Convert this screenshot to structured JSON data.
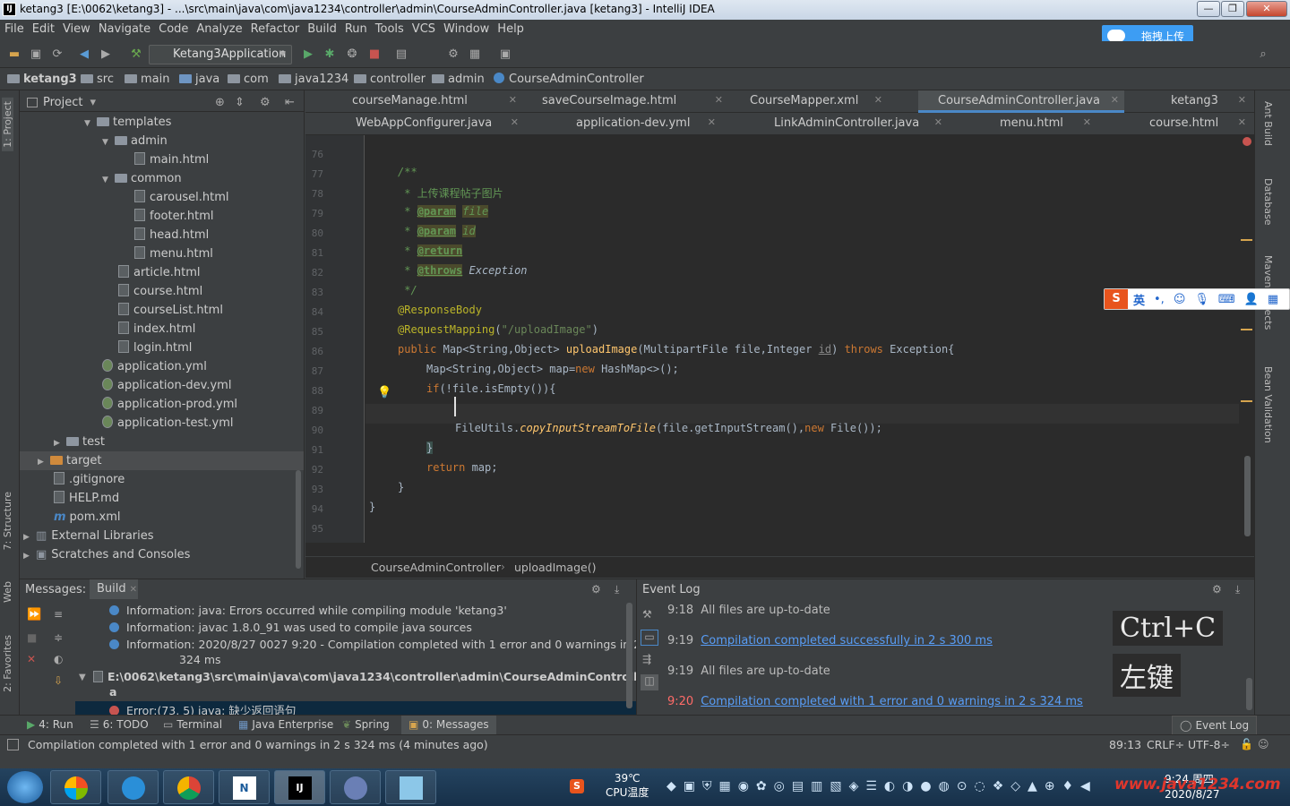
{
  "window": {
    "title": "ketang3 [E:\\0062\\ketang3] - ...\\src\\main\\java\\com\\java1234\\controller\\admin\\CourseAdminController.java [ketang3] - IntelliJ IDEA",
    "icon": "IJ"
  },
  "menu": [
    "File",
    "Edit",
    "View",
    "Navigate",
    "Code",
    "Analyze",
    "Refactor",
    "Build",
    "Run",
    "Tools",
    "VCS",
    "Window",
    "Help"
  ],
  "toolbar": {
    "run_config": "Ketang3Application"
  },
  "upload_button": "拖拽上传",
  "breadcrumb": [
    "ketang3",
    "src",
    "main",
    "java",
    "com",
    "java1234",
    "controller",
    "admin",
    "CourseAdminController"
  ],
  "project_panel": {
    "title": "Project",
    "tree": [
      {
        "label": "templates",
        "type": "folder",
        "open": true
      },
      {
        "label": "admin",
        "type": "folder",
        "open": true
      },
      {
        "label": "main.html",
        "type": "html"
      },
      {
        "label": "common",
        "type": "folder",
        "open": true
      },
      {
        "label": "carousel.html",
        "type": "html"
      },
      {
        "label": "footer.html",
        "type": "html"
      },
      {
        "label": "head.html",
        "type": "html"
      },
      {
        "label": "menu.html",
        "type": "html"
      },
      {
        "label": "article.html",
        "type": "html"
      },
      {
        "label": "course.html",
        "type": "html"
      },
      {
        "label": "courseList.html",
        "type": "html"
      },
      {
        "label": "index.html",
        "type": "html"
      },
      {
        "label": "login.html",
        "type": "html"
      },
      {
        "label": "application.yml",
        "type": "yml"
      },
      {
        "label": "application-dev.yml",
        "type": "yml"
      },
      {
        "label": "application-prod.yml",
        "type": "yml"
      },
      {
        "label": "application-test.yml",
        "type": "yml"
      },
      {
        "label": "test",
        "type": "folder",
        "open": false
      },
      {
        "label": "target",
        "type": "folder-orange",
        "open": false
      },
      {
        "label": ".gitignore",
        "type": "file"
      },
      {
        "label": "HELP.md",
        "type": "file"
      },
      {
        "label": "pom.xml",
        "type": "maven"
      },
      {
        "label": "External Libraries",
        "type": "lib",
        "open": false
      },
      {
        "label": "Scratches and Consoles",
        "type": "lib",
        "open": false
      }
    ]
  },
  "tabs_row1": [
    "courseManage.html",
    "saveCourseImage.html",
    "CourseMapper.xml",
    "CourseAdminController.java",
    "ketang3"
  ],
  "tabs_row2": [
    "WebAppConfigurer.java",
    "application-dev.yml",
    "LinkAdminController.java",
    "menu.html",
    "course.html"
  ],
  "active_tab": "CourseAdminController.java",
  "line_numbers": [
    "76",
    "77",
    "78",
    "79",
    "80",
    "81",
    "82",
    "83",
    "84",
    "85",
    "86",
    "87",
    "88",
    "89",
    "90",
    "91",
    "92",
    "93",
    "94",
    "95"
  ],
  "code": {
    "l77": "/**",
    "l78": " * 上传课程帖子图片",
    "l79_tag": "@param",
    "l79_name": "file",
    "l80_tag": "@param",
    "l80_name": "id",
    "l81_tag": "@return",
    "l82_tag": "@throws",
    "l82_name": "Exception",
    "l83": " */",
    "l84": "@ResponseBody",
    "l85_ann": "@RequestMapping",
    "l85_str": "\"/uploadImage\"",
    "l86_kw": "public",
    "l86_type": "Map<String,Object>",
    "l86_fn": "uploadImage",
    "l86_params": "(MultipartFile file,Integer ",
    "l86_id": "id",
    "l86_throws": "throws",
    "l86_exc": "Exception{",
    "l87_a": "Map<String,Object> map=",
    "l87_kw": "new",
    "l87_b": " HashMap<>();",
    "l88_kw": "if",
    "l88_b": "(!file.isEmpty()){",
    "l90_a": "FileUtils.",
    "l90_fn": "copyInputStreamToFile",
    "l90_b": "(file.getInputStream(),",
    "l90_kw": "new",
    "l90_c": " File());",
    "l91": "}",
    "l92_kw": "return",
    "l92_b": " map;",
    "l93": "}",
    "l94": "}"
  },
  "editor_crumb": [
    "CourseAdminController",
    "uploadImage()"
  ],
  "messages_panel": {
    "tabs": [
      "Messages:",
      "Build"
    ],
    "lines": [
      "Information: java: Errors occurred while compiling module 'ketang3'",
      "Information: javac 1.8.0_91 was used to compile java sources",
      "Information: 2020/8/27 0027 9:20 - Compilation completed with 1 error and 0 warnings in 2 s",
      "324 ms"
    ],
    "file_path": "E:\\0062\\ketang3\\src\\main\\java\\com\\java1234\\controller\\admin\\CourseAdminController.jav",
    "file_path_wrap": "a",
    "error_line": "Error:(73, 5)  java: 缺少返回语句"
  },
  "event_log": {
    "title": "Event Log",
    "entries": [
      {
        "time": "9:18",
        "text": "All files are up-to-date",
        "link": false,
        "error": false
      },
      {
        "time": "9:19",
        "text": "Compilation completed successfully in 2 s 300 ms",
        "link": true,
        "error": false
      },
      {
        "time": "9:19",
        "text": "All files are up-to-date",
        "link": false,
        "error": false
      },
      {
        "time": "9:20",
        "text": "Compilation completed with 1 error and 0 warnings in 2 s 324 ms",
        "link": true,
        "error": true
      }
    ]
  },
  "key_overlay": [
    "Ctrl+C",
    "左键"
  ],
  "bottom_tabs": [
    "4: Run",
    "6: TODO",
    "Terminal",
    "Java Enterprise",
    "Spring",
    "0: Messages"
  ],
  "bottom_right_tab": "Event Log",
  "status": {
    "message": "Compilation completed with 1 error and 0 warnings in 2 s 324 ms (4 minutes ago)",
    "position": "89:13",
    "line_sep": "CRLF÷",
    "encoding": "UTF-8÷"
  },
  "left_tool_tabs": [
    "1: Project",
    "7: Structure",
    "Web",
    "2: Favorites"
  ],
  "right_tool_tabs": [
    "Ant Build",
    "Database",
    "Maven Projects",
    "Bean Validation"
  ],
  "ime_bar": {
    "lang": "英"
  },
  "taskbar": {
    "temp": "39℃",
    "temp_label": "CPU温度",
    "time": "9:24 周四",
    "date": "2020/8/27",
    "watermark": "www.java1234.com"
  }
}
